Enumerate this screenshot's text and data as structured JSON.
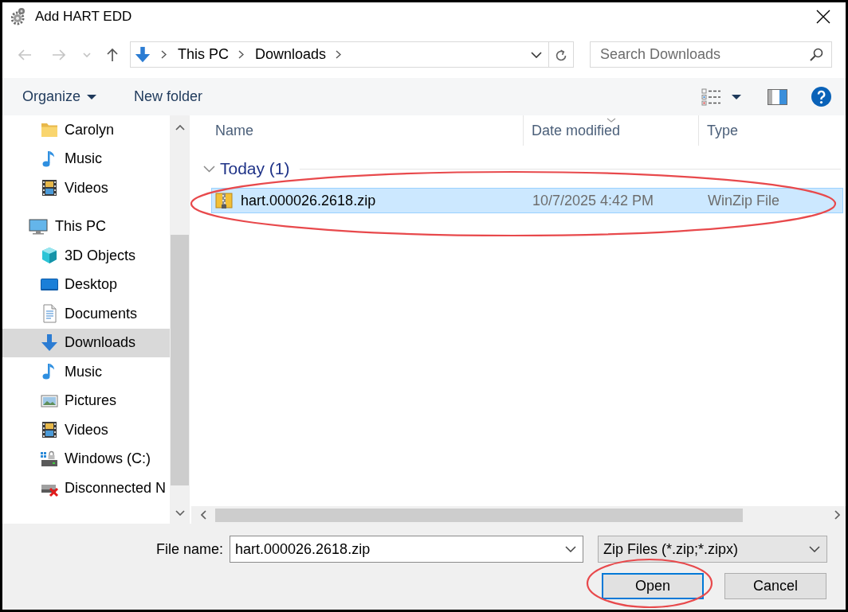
{
  "window": {
    "title": "Add HART EDD"
  },
  "navigation": {
    "buttons": [
      {
        "kind": "back",
        "disabled": true
      },
      {
        "kind": "forward",
        "disabled": true
      },
      {
        "kind": "recent",
        "disabled": true
      },
      {
        "kind": "up",
        "disabled": false
      }
    ],
    "breadcrumbs": [
      "This PC",
      "Downloads"
    ],
    "search": {
      "placeholder": "Search Downloads"
    }
  },
  "toolbar": {
    "items": [
      {
        "kind": "menu",
        "label": "Organize"
      },
      {
        "kind": "button",
        "label": "New folder"
      }
    ]
  },
  "sidebar": {
    "continued_items": [
      {
        "label": "Carolyn",
        "kind": "folder",
        "selected": false
      },
      {
        "label": "Music",
        "kind": "music",
        "selected": false
      },
      {
        "label": "Videos",
        "kind": "videos",
        "selected": false
      }
    ],
    "items": [
      {
        "label": "This PC",
        "kind": "pc",
        "selected": false,
        "children": [
          {
            "label": "3D Objects",
            "kind": "objects3d",
            "selected": false
          },
          {
            "label": "Desktop",
            "kind": "desktop",
            "selected": false
          },
          {
            "label": "Documents",
            "kind": "documents",
            "selected": false
          },
          {
            "label": "Downloads",
            "kind": "downloads",
            "selected": true
          },
          {
            "label": "Music",
            "kind": "music",
            "selected": false
          },
          {
            "label": "Pictures",
            "kind": "pictures",
            "selected": false
          },
          {
            "label": "Videos",
            "kind": "videos",
            "selected": false
          },
          {
            "label": "Windows (C:)",
            "kind": "drive",
            "selected": false
          },
          {
            "label": "Disconnected N",
            "kind": "network_drive",
            "selected": false
          }
        ]
      }
    ]
  },
  "file_list": {
    "columns": [
      {
        "label": "Name",
        "sorted": false
      },
      {
        "label": "Date modified",
        "sorted": true
      },
      {
        "label": "Type",
        "sorted": false
      }
    ],
    "groups": [
      {
        "label": "Today (1)",
        "expanded": true,
        "rows": [
          {
            "cells": [
              "hart.000026.2618.zip",
              "10/7/2025 4:42 PM",
              "WinZip File"
            ],
            "selected": true,
            "circled": true
          }
        ]
      }
    ]
  },
  "footer": {
    "file_name_label": "File name:",
    "file_name": "hart.000026.2618.zip",
    "file_type_filter": "Zip Files (*.zip;*.zipx)",
    "buttons": [
      {
        "label": "Open",
        "default": true,
        "circled": true
      },
      {
        "label": "Cancel",
        "default": false,
        "circled": false
      }
    ]
  }
}
